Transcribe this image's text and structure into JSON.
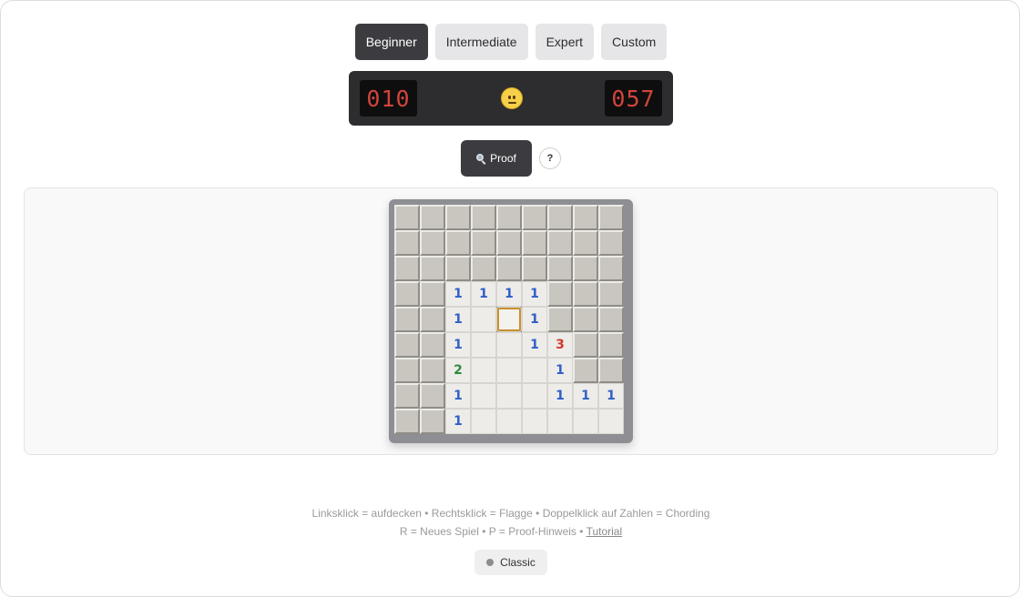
{
  "levels": [
    {
      "label": "Beginner",
      "active": true
    },
    {
      "label": "Intermediate",
      "active": false
    },
    {
      "label": "Expert",
      "active": false
    },
    {
      "label": "Custom",
      "active": false
    }
  ],
  "status": {
    "mine_counter": "010",
    "timer": "057",
    "face": "smiley-icon"
  },
  "proof_button": {
    "label": "Proof",
    "icon": "magnifier-icon"
  },
  "help_button": {
    "label": "?"
  },
  "board": {
    "rows": 9,
    "cols": 9,
    "cells": [
      [
        "#",
        "#",
        "#",
        "#",
        "#",
        "#",
        "#",
        "#",
        "#"
      ],
      [
        "#",
        "#",
        "#",
        "#",
        "#",
        "#",
        "#",
        "#",
        "#"
      ],
      [
        "#",
        "#",
        "#",
        "#",
        "#",
        "#",
        "#",
        "#",
        "#"
      ],
      [
        "#",
        "#",
        "1",
        "1",
        "1",
        "1",
        "#",
        "#",
        "#"
      ],
      [
        "#",
        "#",
        "1",
        "",
        "*",
        "1",
        "#",
        "#",
        "#"
      ],
      [
        "#",
        "#",
        "1",
        "",
        "",
        "1",
        "3",
        "#",
        "#"
      ],
      [
        "#",
        "#",
        "2",
        "",
        "",
        "",
        "1",
        "#",
        "#"
      ],
      [
        "#",
        "#",
        "1",
        "",
        "",
        "",
        "1",
        "1",
        "1"
      ],
      [
        "#",
        "#",
        "1",
        "",
        "",
        "",
        "",
        "",
        ""
      ]
    ],
    "number_colors": {
      "1": "#2f5fc7",
      "2": "#2f8a3e",
      "3": "#d0392e"
    },
    "selected_color": "#c9902e"
  },
  "hints": {
    "line1": "Linksklick = aufdecken • Rechtsklick = Flagge • Doppelklick auf Zahlen = Chording",
    "line2_prefix": "R = Neues Spiel • P = Proof-Hinweis • ",
    "tutorial_link": "Tutorial"
  },
  "theme": {
    "label": "Classic"
  }
}
